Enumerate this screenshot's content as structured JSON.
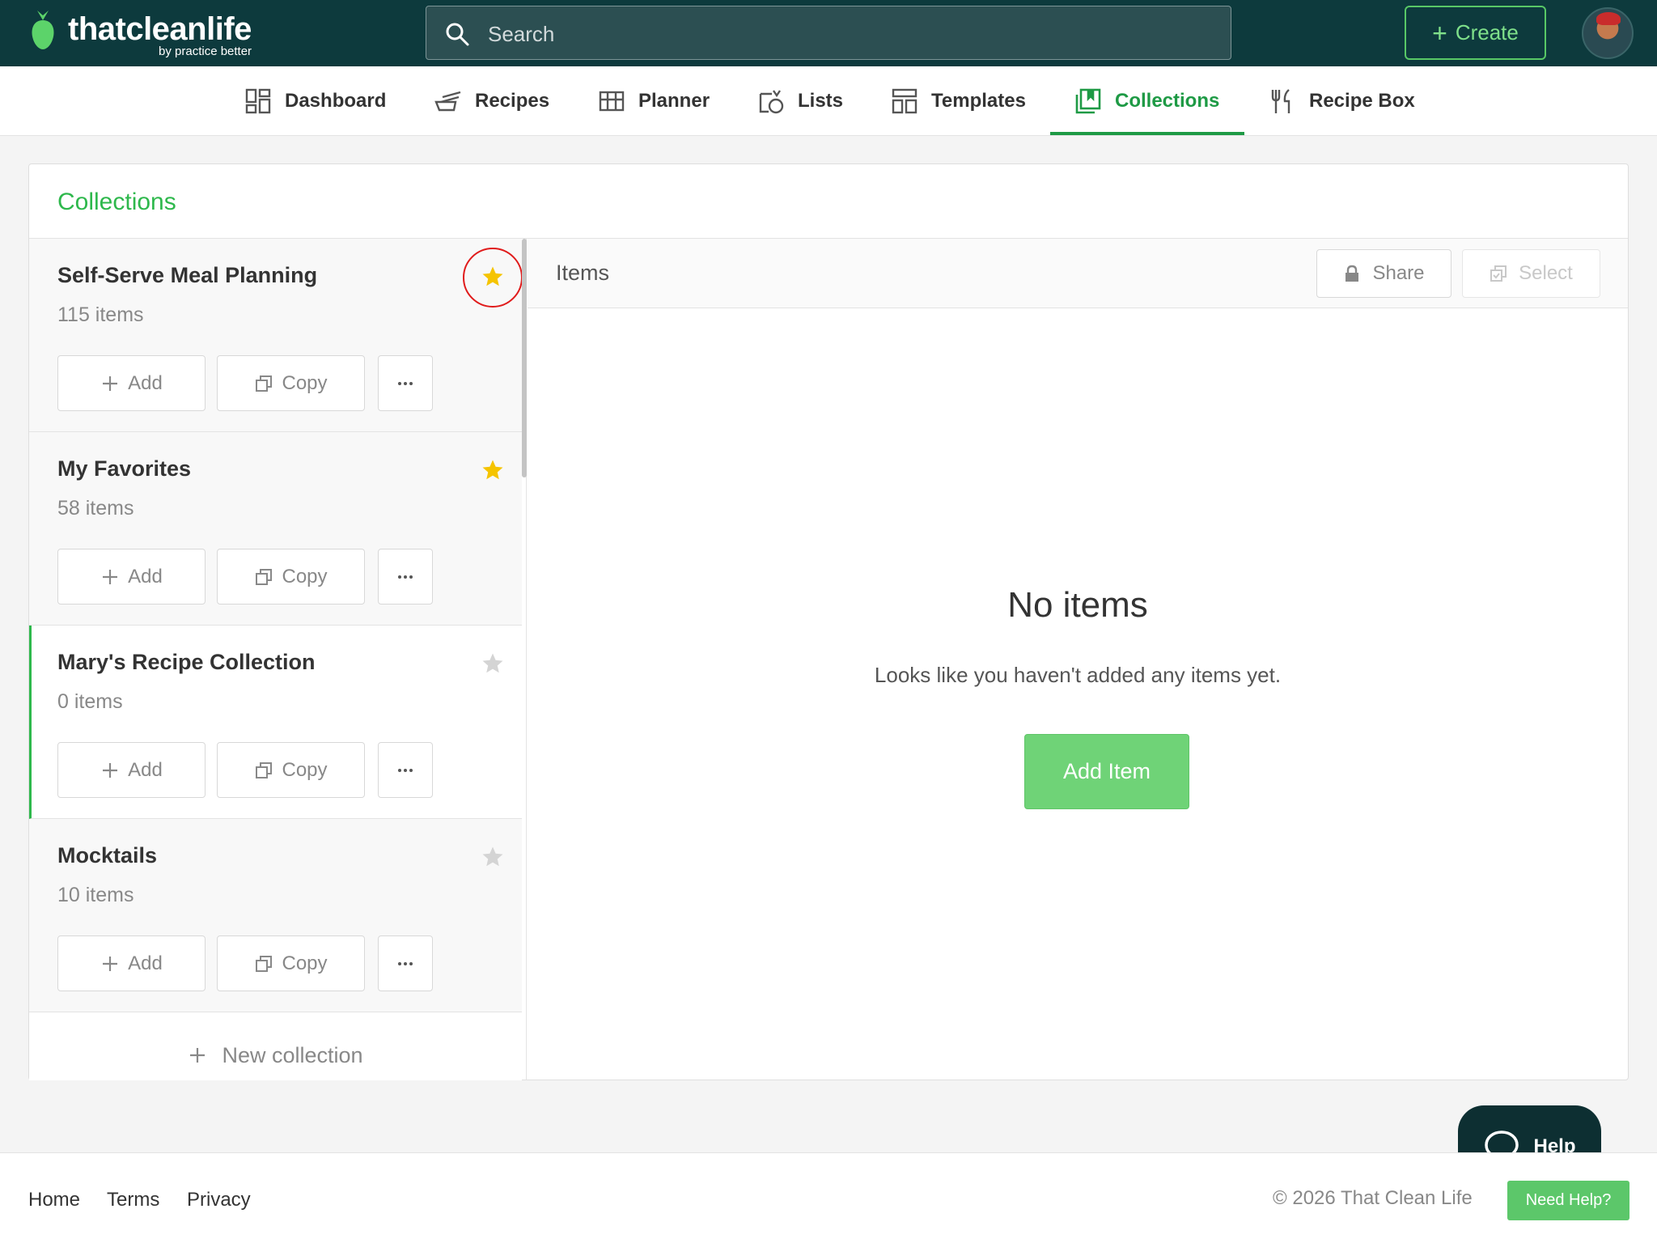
{
  "header": {
    "logo_text": "thatcleanlife",
    "logo_sub": "by practice better",
    "search_placeholder": "Search",
    "create_label": "Create"
  },
  "nav": {
    "items": [
      {
        "label": "Dashboard",
        "icon": "dashboard-icon"
      },
      {
        "label": "Recipes",
        "icon": "recipes-icon"
      },
      {
        "label": "Planner",
        "icon": "planner-icon"
      },
      {
        "label": "Lists",
        "icon": "lists-icon"
      },
      {
        "label": "Templates",
        "icon": "templates-icon"
      },
      {
        "label": "Collections",
        "icon": "collections-icon",
        "active": true
      },
      {
        "label": "Recipe Box",
        "icon": "recipe-box-icon"
      }
    ]
  },
  "page": {
    "title": "Collections"
  },
  "collections": [
    {
      "name": "Self-Serve Meal Planning",
      "count": "115 items",
      "favorite": true
    },
    {
      "name": "My Favorites",
      "count": "58 items",
      "favorite": true
    },
    {
      "name": "Mary's Recipe Collection",
      "count": "0 items",
      "favorite": false,
      "selected": true
    },
    {
      "name": "Mocktails",
      "count": "10 items",
      "favorite": false
    }
  ],
  "collection_actions": {
    "add": "Add",
    "copy": "Copy"
  },
  "new_collection": "New collection",
  "items_panel": {
    "label": "Items",
    "share": "Share",
    "select": "Select",
    "empty_title": "No items",
    "empty_subtitle": "Looks like you haven't added any items yet.",
    "add_item": "Add Item"
  },
  "help": {
    "bubble_label": "Help",
    "need_help": "Need Help?"
  },
  "footer": {
    "links": [
      "Home",
      "Terms",
      "Privacy"
    ],
    "copyright": "© 2026 That Clean Life"
  },
  "colors": {
    "brand_dark": "#0d3a3d",
    "accent_green": "#1e9a45",
    "title_green": "#2eb84c",
    "star_active": "#f5c400",
    "star_inactive": "#d4d4d4",
    "highlight_ring": "#e01b1b"
  }
}
